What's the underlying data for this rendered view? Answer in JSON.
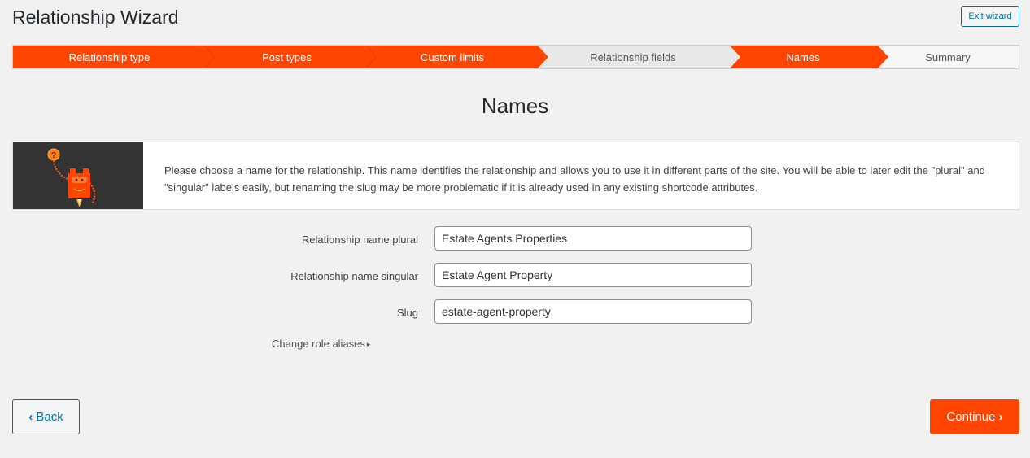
{
  "header": {
    "title": "Relationship Wizard",
    "exit_label": "Exit wizard"
  },
  "steps": [
    {
      "label": "Relationship type",
      "state": "done"
    },
    {
      "label": "Post types",
      "state": "done"
    },
    {
      "label": "Custom limits",
      "state": "done"
    },
    {
      "label": "Relationship fields",
      "state": "skipped"
    },
    {
      "label": "Names",
      "state": "active"
    },
    {
      "label": "Summary",
      "state": "pending"
    }
  ],
  "section": {
    "title": "Names"
  },
  "info": {
    "icon": "robot-help-icon",
    "text": "Please choose a name for the relationship. This name identifies the relationship and allows you to use it in different parts of the site. You will be able to later edit the \"plural\" and \"singular\" labels easily, but renaming the slug may be more problematic if it is already used in any existing shortcode attributes."
  },
  "form": {
    "plural": {
      "label": "Relationship name plural",
      "value": "Estate Agents Properties"
    },
    "singular": {
      "label": "Relationship name singular",
      "value": "Estate Agent Property"
    },
    "slug": {
      "label": "Slug",
      "value": "estate-agent-property"
    },
    "aliases_link": "Change role aliases",
    "aliases_icon": "▸"
  },
  "footer": {
    "back_label": "Back",
    "back_icon": "‹",
    "continue_label": "Continue",
    "continue_icon": "›"
  },
  "colors": {
    "accent": "#ff4500",
    "link": "#0071a1",
    "step_pending": "#e9e9e9",
    "step_last": "#f7f7f7"
  }
}
